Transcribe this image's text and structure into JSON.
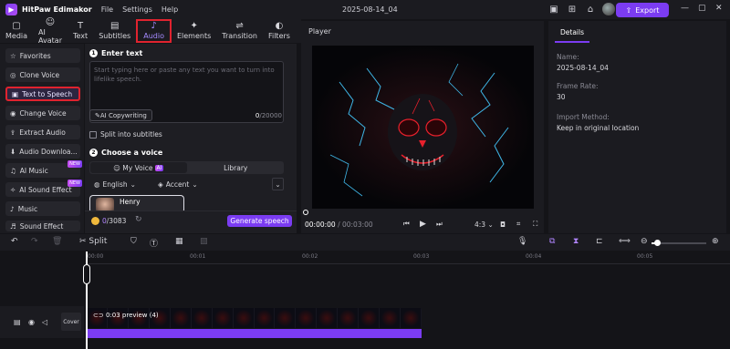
{
  "app": {
    "name": "HitPaw Edimakor",
    "logo_glyph": "▶",
    "doc_title": "2025-08-14_04"
  },
  "menu": [
    "File",
    "Settings",
    "Help"
  ],
  "header": {
    "export_label": "Export"
  },
  "toolbar": {
    "tabs": [
      {
        "label": "Media",
        "icon": "media-icon",
        "glyph": "▢"
      },
      {
        "label": "AI Avatar",
        "icon": "ai-avatar-icon",
        "glyph": "☺"
      },
      {
        "label": "Text",
        "icon": "text-icon",
        "glyph": "T"
      },
      {
        "label": "Subtitles",
        "icon": "subtitles-icon",
        "glyph": "▤"
      },
      {
        "label": "Audio",
        "icon": "audio-icon",
        "glyph": "♪"
      },
      {
        "label": "Elements",
        "icon": "elements-icon",
        "glyph": "✦"
      },
      {
        "label": "Transition",
        "icon": "transition-icon",
        "glyph": "⇌"
      },
      {
        "label": "Filters",
        "icon": "filters-icon",
        "glyph": "◐"
      }
    ],
    "active": "Audio"
  },
  "sidebar": {
    "items": [
      {
        "label": "Favorites",
        "glyph": "☆"
      },
      {
        "label": "Clone Voice",
        "glyph": "◎"
      },
      {
        "label": "Text to Speech",
        "glyph": "▣"
      },
      {
        "label": "Change Voice",
        "glyph": "◉"
      },
      {
        "label": "Extract Audio",
        "glyph": "⇪"
      },
      {
        "label": "Audio Downloa...",
        "glyph": "⬇"
      },
      {
        "label": "AI Music",
        "glyph": "♫",
        "badge": "NEW"
      },
      {
        "label": "AI Sound Effect",
        "glyph": "✧",
        "badge": "NEW"
      },
      {
        "label": "Music",
        "glyph": "♪"
      },
      {
        "label": "Sound Effect",
        "glyph": "♬"
      }
    ],
    "active": "Text to Speech"
  },
  "tts": {
    "step1_num": "1",
    "step1_title": "Enter text",
    "placeholder": "Start typing here or paste any text you want to turn into lifelike speech.",
    "ai_copy_label": "AI Copywriting",
    "counter_used": "0",
    "counter_max": "/20000",
    "split_label": "Split into subtitles",
    "step2_num": "2",
    "step2_title": "Choose a voice",
    "tab_my_voice": "My Voice",
    "tab_ai_tag": "AI",
    "tab_library": "Library",
    "language": "English",
    "accent": "Accent",
    "voice_name": "Henry",
    "credits_used": "0",
    "credits_total": "/3083",
    "generate_label": "Generate speech"
  },
  "player": {
    "title": "Player",
    "time_current": "00:00:00",
    "time_total": "/ 00:03:00",
    "aspect": "4:3"
  },
  "details": {
    "tab": "Details",
    "name_label": "Name:",
    "name_value": "2025-08-14_04",
    "fps_label": "Frame Rate:",
    "fps_value": "30",
    "import_label": "Import Method:",
    "import_value": "Keep in original location"
  },
  "timeline": {
    "split_label": "Split",
    "ticks": [
      "00:00",
      "00:01",
      "00:02",
      "00:03",
      "00:04",
      "00:05"
    ],
    "cover_label": "Cover",
    "clip_label": "0:03 preview (4)"
  },
  "colors": {
    "accent": "#7b3cf2",
    "highlight": "#e0232f"
  }
}
